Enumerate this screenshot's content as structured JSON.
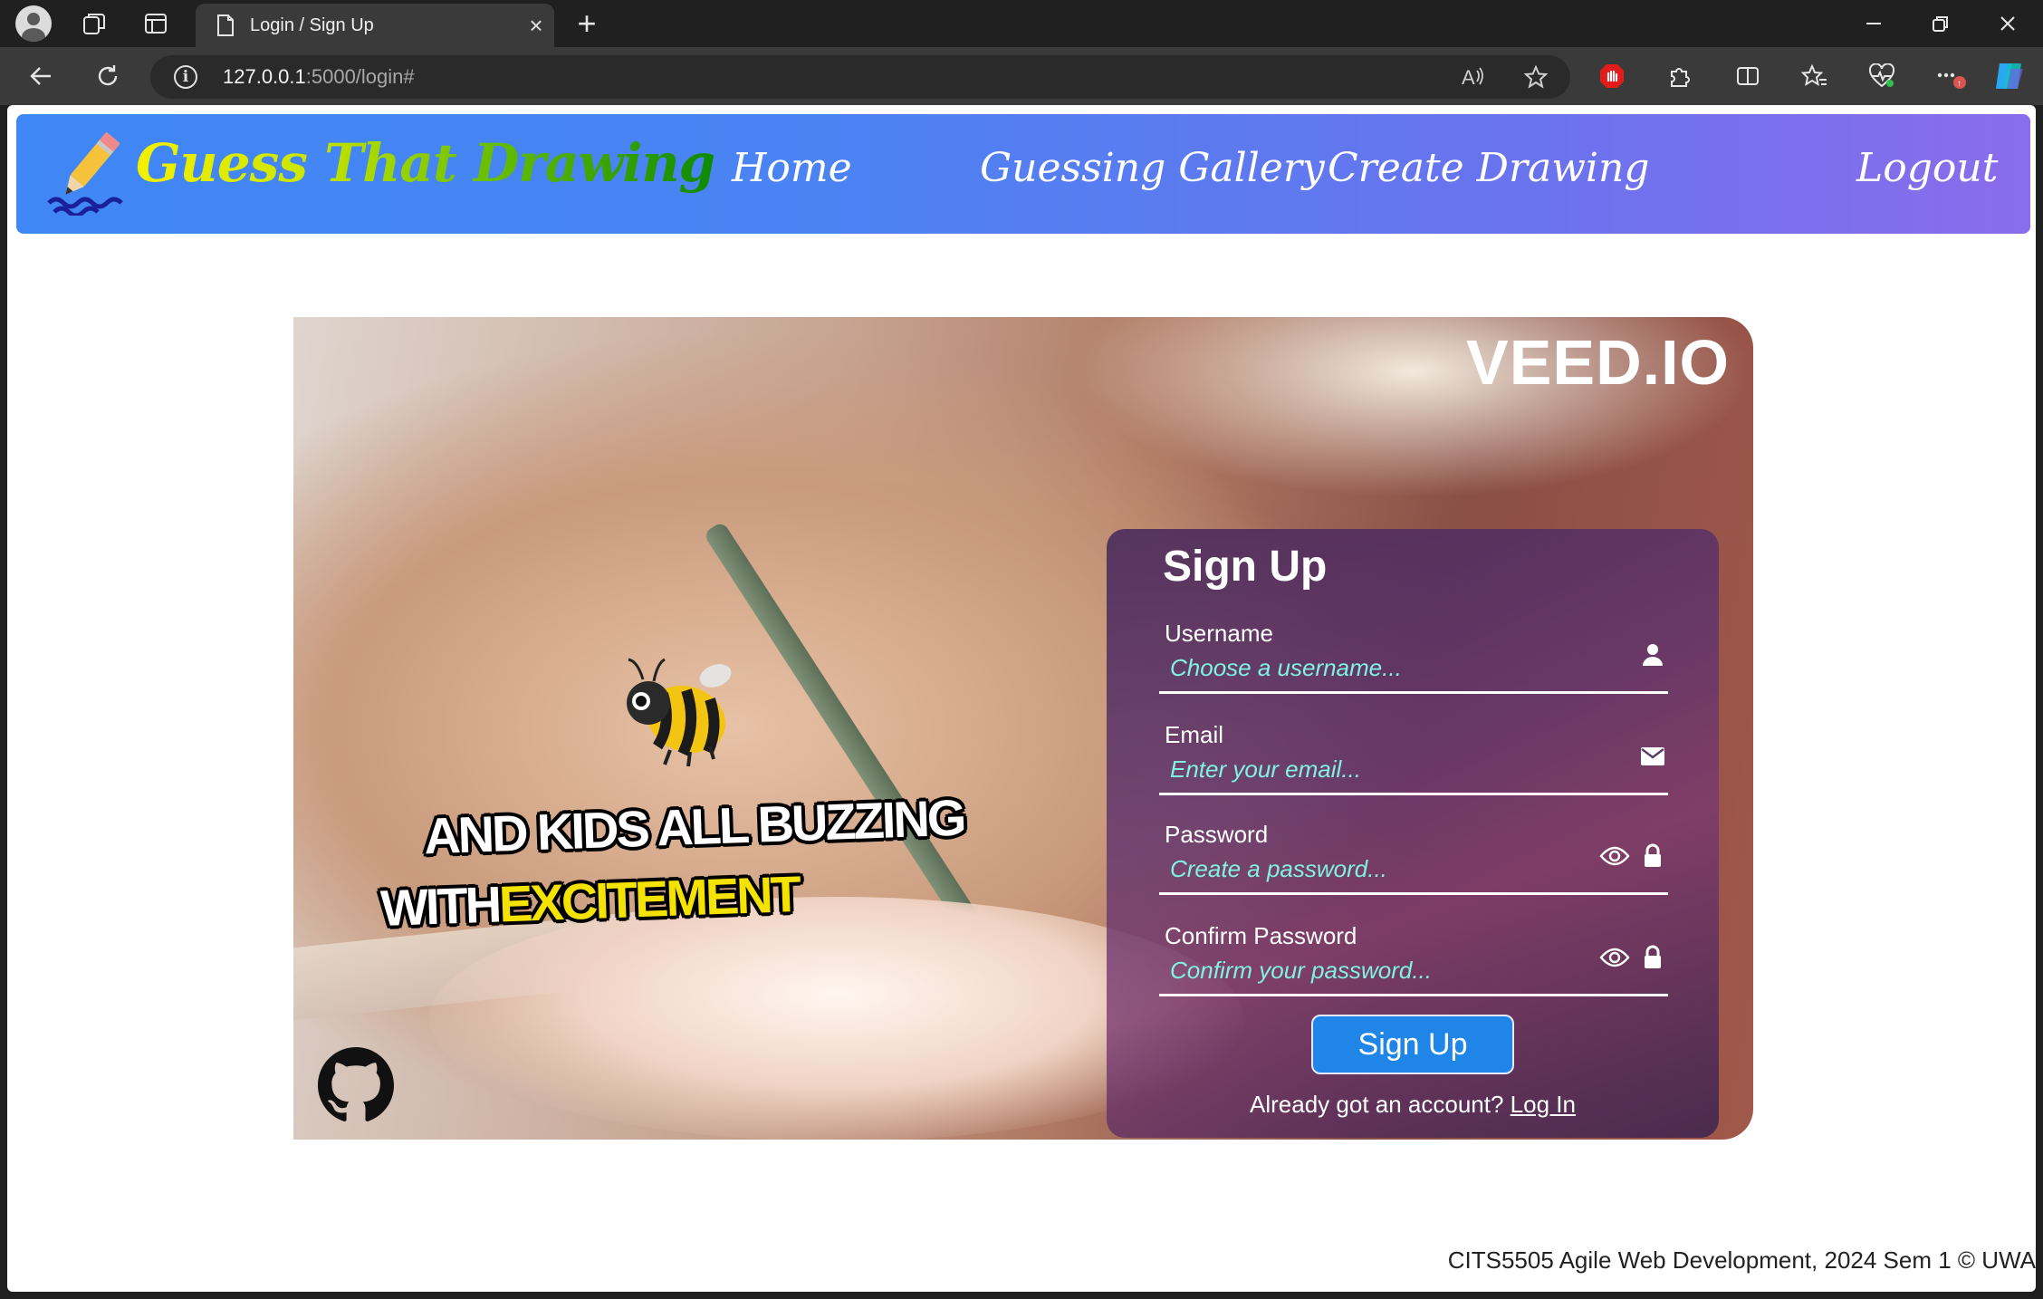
{
  "browser": {
    "tab_title": "Login / Sign Up",
    "url_host": "127.0.0.1",
    "url_rest": ":5000/login#"
  },
  "navbar": {
    "brand": "Guess That Drawing",
    "links": {
      "home": "Home",
      "gallery": "Guessing Gallery",
      "create": "Create Drawing",
      "logout": "Logout"
    }
  },
  "hero": {
    "watermark": "VEED.IO",
    "caption_line1": "AND KIDS ALL BUZZING",
    "caption_line2_a": "WITH",
    "caption_line2_b": "EXCITEMENT"
  },
  "form": {
    "title": "Sign Up",
    "fields": {
      "username": {
        "label": "Username",
        "placeholder": "Choose a username..."
      },
      "email": {
        "label": "Email",
        "placeholder": "Enter your email..."
      },
      "password": {
        "label": "Password",
        "placeholder": "Create a password..."
      },
      "confirm": {
        "label": "Confirm Password",
        "placeholder": "Confirm your password..."
      }
    },
    "submit_label": "Sign Up",
    "switch_text": "Already got an account?",
    "switch_link": "Log In"
  },
  "footer": {
    "text": "CITS5505 Agile Web Development, 2024 Sem 1 © UWA"
  },
  "colors": {
    "nav_gradient_start": "#3f87f5",
    "nav_gradient_end": "#8a6cec",
    "placeholder": "#7ff2e2",
    "button": "#1f86e8"
  }
}
